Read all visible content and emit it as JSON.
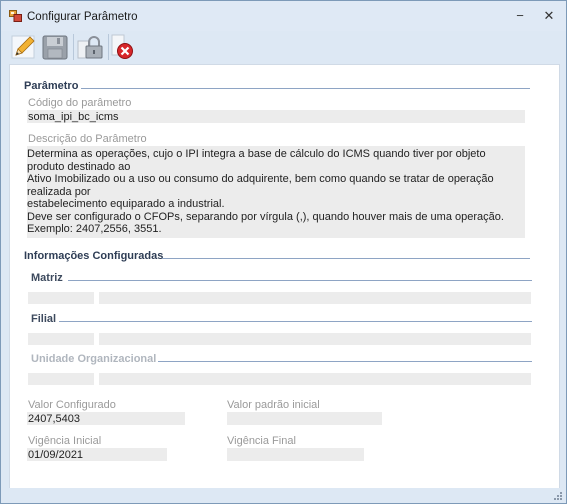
{
  "window": {
    "title": "Configurar Parâmetro",
    "minimize_glyph": "−",
    "close_glyph": "✕"
  },
  "toolbar": {
    "buttons": [
      {
        "name": "edit-button",
        "icon": "pencil-icon"
      },
      {
        "name": "save-button",
        "icon": "floppy-disk-icon"
      },
      {
        "name": "lock-button",
        "icon": "padlock-icon"
      },
      {
        "name": "cancel-button",
        "icon": "red-x-circle-icon"
      }
    ]
  },
  "parametro": {
    "group_title": "Parâmetro",
    "codigo_label": "Código do parâmetro",
    "codigo_value": "soma_ipi_bc_icms",
    "descricao_label": "Descrição do Parâmetro",
    "descricao_value": "Determina as operações, cujo o IPI integra a base de cálculo do ICMS quando tiver por objeto produto destinado ao\nAtivo Imobilizado ou a uso ou consumo do adquirente, bem como quando se tratar de operação realizada por\nestabelecimento equiparado a industrial.\nDeve ser configurado o CFOPs, separando por vírgula (,), quando houver mais de uma operação.\nExemplo: 2407,2556, 3551."
  },
  "informacoes": {
    "group_title": "Informações Configuradas",
    "matriz_title": "Matriz",
    "filial_title": "Filial",
    "unidade_title": "Unidade Organizacional"
  },
  "valores": {
    "valor_configurado_label": "Valor Configurado",
    "valor_configurado_value": "2407,5403",
    "valor_padrao_label": "Valor padrão inicial",
    "valor_padrao_value": "",
    "vigencia_inicial_label": "Vigência Inicial",
    "vigencia_inicial_value": "01/09/2021",
    "vigencia_final_label": "Vigência Final",
    "vigencia_final_value": ""
  },
  "colors": {
    "chrome": "#dde8f4",
    "field_bg": "#ececec",
    "group_title": "#2e3d55",
    "group_line": "#8ea4c4",
    "label": "#9a9a9a",
    "cancel_red": "#d7262a"
  }
}
